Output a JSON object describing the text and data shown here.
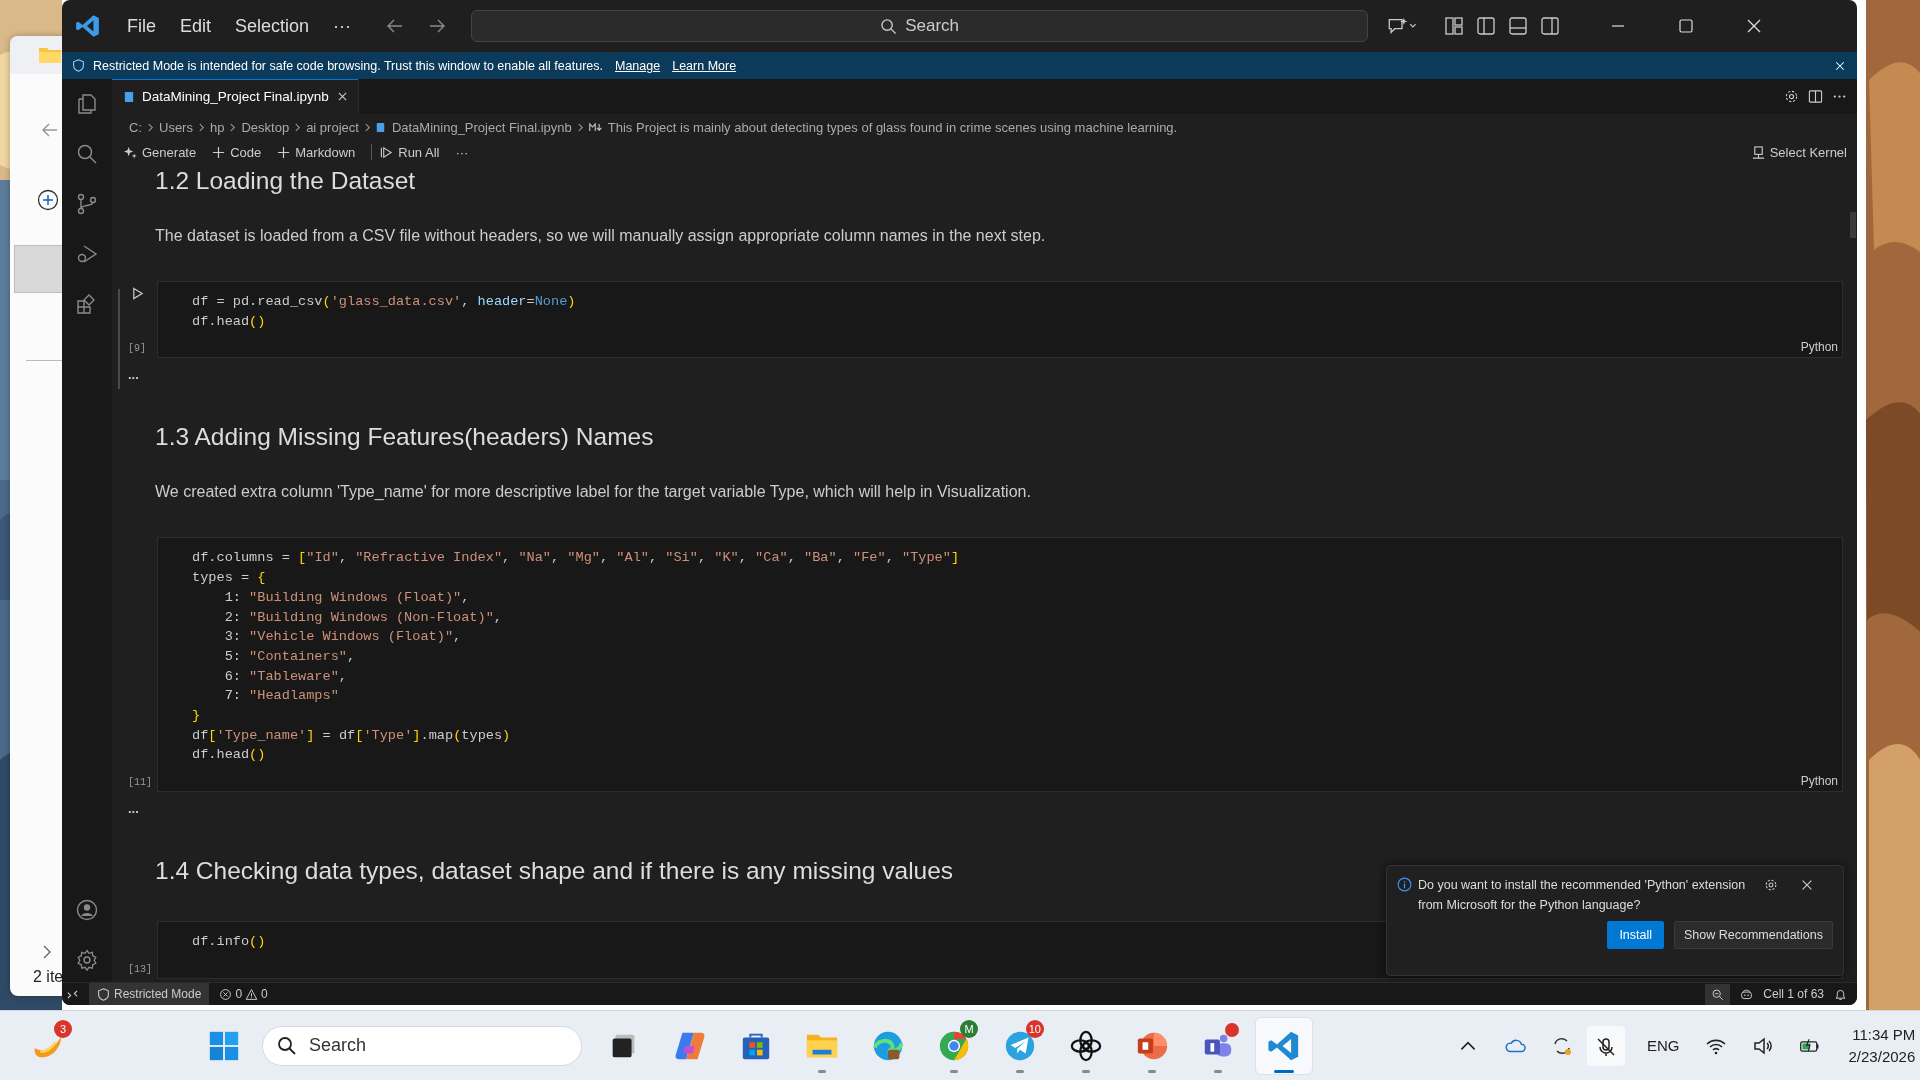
{
  "explorer_window": {
    "status_text": "2 ite"
  },
  "vscode": {
    "menu": [
      "File",
      "Edit",
      "Selection",
      "···"
    ],
    "command_center": {
      "placeholder": "Search"
    },
    "banner": {
      "message": "Restricted Mode is intended for safe code browsing. Trust this window to enable all features.",
      "links": [
        "Manage",
        "Learn More"
      ]
    },
    "tabs": [
      {
        "label": "DataMining_Project Final.ipynb",
        "selected": true
      }
    ],
    "breadcrumbs": [
      {
        "label": "C:",
        "kind": "plain"
      },
      {
        "label": "Users",
        "kind": "plain"
      },
      {
        "label": "hp",
        "kind": "plain"
      },
      {
        "label": "Desktop",
        "kind": "plain"
      },
      {
        "label": "ai project",
        "kind": "plain"
      },
      {
        "label": "DataMining_Project Final.ipynb",
        "kind": "notebook"
      },
      {
        "label": "This Project is mainly about detecting types of glass found in crime scenes using machine learning.",
        "kind": "markdown"
      }
    ],
    "toolbar": [
      {
        "label": "Generate",
        "kind": "sparkle"
      },
      {
        "label": "Code",
        "kind": "add"
      },
      {
        "label": "Markdown",
        "kind": "add"
      },
      {
        "label": "Run All",
        "kind": "run"
      },
      {
        "label": "···",
        "kind": "more"
      }
    ],
    "kernel": "Select Kernel",
    "cells": [
      {
        "kind": "markdown",
        "heading": "1.2 Loading the Dataset",
        "text": "The dataset is loaded from a CSV file without headers, so we will manually assign appropriate column names in the next step."
      },
      {
        "kind": "code",
        "focused": true,
        "execution_count": "[9]",
        "language": "Python",
        "output": "...",
        "lines": [
          [
            {
              "kind": "plain",
              "text": "df = pd.read_csv"
            },
            {
              "kind": "bracket",
              "text": "("
            },
            {
              "kind": "string",
              "text": "'glass_data.csv'"
            },
            {
              "kind": "plain",
              "text": ", "
            },
            {
              "kind": "param",
              "text": "header"
            },
            {
              "kind": "plain",
              "text": "="
            },
            {
              "kind": "keyword",
              "text": "None"
            },
            {
              "kind": "bracket",
              "text": ")"
            }
          ],
          [
            {
              "kind": "plain",
              "text": "df.head"
            },
            {
              "kind": "bracket",
              "text": "()"
            }
          ]
        ]
      },
      {
        "kind": "markdown",
        "heading": "1.3 Adding Missing Features(headers) Names",
        "text": "We created extra column 'Type_name' for more descriptive label for the target variable Type, which will help in Visualization."
      },
      {
        "kind": "code",
        "focused": false,
        "execution_count": "[11]",
        "language": "Python",
        "output": "...",
        "lines": [
          [
            {
              "kind": "plain",
              "text": "df.columns = "
            },
            {
              "kind": "bracket",
              "text": "["
            },
            {
              "kind": "string",
              "text": "\"Id\""
            },
            {
              "kind": "plain",
              "text": ", "
            },
            {
              "kind": "string",
              "text": "\"Refractive Index\""
            },
            {
              "kind": "plain",
              "text": ", "
            },
            {
              "kind": "string",
              "text": "\"Na\""
            },
            {
              "kind": "plain",
              "text": ", "
            },
            {
              "kind": "string",
              "text": "\"Mg\""
            },
            {
              "kind": "plain",
              "text": ", "
            },
            {
              "kind": "string",
              "text": "\"Al\""
            },
            {
              "kind": "plain",
              "text": ", "
            },
            {
              "kind": "string",
              "text": "\"Si\""
            },
            {
              "kind": "plain",
              "text": ", "
            },
            {
              "kind": "string",
              "text": "\"K\""
            },
            {
              "kind": "plain",
              "text": ", "
            },
            {
              "kind": "string",
              "text": "\"Ca\""
            },
            {
              "kind": "plain",
              "text": ", "
            },
            {
              "kind": "string",
              "text": "\"Ba\""
            },
            {
              "kind": "plain",
              "text": ", "
            },
            {
              "kind": "string",
              "text": "\"Fe\""
            },
            {
              "kind": "plain",
              "text": ", "
            },
            {
              "kind": "string",
              "text": "\"Type\""
            },
            {
              "kind": "bracket",
              "text": "]"
            }
          ],
          [
            {
              "kind": "plain",
              "text": "types = "
            },
            {
              "kind": "bracket",
              "text": "{"
            }
          ],
          [
            {
              "kind": "plain",
              "text": "    1: "
            },
            {
              "kind": "string",
              "text": "\"Building Windows (Float)\""
            },
            {
              "kind": "plain",
              "text": ","
            }
          ],
          [
            {
              "kind": "plain",
              "text": "    2: "
            },
            {
              "kind": "string",
              "text": "\"Building Windows (Non-Float)\""
            },
            {
              "kind": "plain",
              "text": ","
            }
          ],
          [
            {
              "kind": "plain",
              "text": "    3: "
            },
            {
              "kind": "string",
              "text": "\"Vehicle Windows (Float)\""
            },
            {
              "kind": "plain",
              "text": ","
            }
          ],
          [
            {
              "kind": "plain",
              "text": "    5: "
            },
            {
              "kind": "string",
              "text": "\"Containers\""
            },
            {
              "kind": "plain",
              "text": ","
            }
          ],
          [
            {
              "kind": "plain",
              "text": "    6: "
            },
            {
              "kind": "string",
              "text": "\"Tableware\""
            },
            {
              "kind": "plain",
              "text": ","
            }
          ],
          [
            {
              "kind": "plain",
              "text": "    7: "
            },
            {
              "kind": "string",
              "text": "\"Headlamps\""
            }
          ],
          [
            {
              "kind": "bracket",
              "text": "}"
            }
          ],
          [
            {
              "kind": "plain",
              "text": "df"
            },
            {
              "kind": "bracket",
              "text": "["
            },
            {
              "kind": "string",
              "text": "'Type_name'"
            },
            {
              "kind": "bracket",
              "text": "]"
            },
            {
              "kind": "plain",
              "text": " = df"
            },
            {
              "kind": "bracket",
              "text": "["
            },
            {
              "kind": "string",
              "text": "'Type'"
            },
            {
              "kind": "bracket",
              "text": "]"
            },
            {
              "kind": "plain",
              "text": ".map"
            },
            {
              "kind": "bracket",
              "text": "("
            },
            {
              "kind": "plain",
              "text": "types"
            },
            {
              "kind": "bracket",
              "text": ")"
            }
          ],
          [
            {
              "kind": "plain",
              "text": "df.head"
            },
            {
              "kind": "bracket",
              "text": "()"
            }
          ]
        ]
      },
      {
        "kind": "markdown",
        "heading": "1.4 Checking data types, dataset shape and if there is any missing values"
      },
      {
        "kind": "code",
        "focused": false,
        "execution_count": "[13]",
        "lines": [
          [
            {
              "kind": "plain",
              "text": "df.info"
            },
            {
              "kind": "bracket",
              "text": "()"
            }
          ]
        ]
      }
    ],
    "notification": {
      "message": "Do you want to install the recommended 'Python' extension from Microsoft for the Python language?",
      "buttons": [
        {
          "label": "Install",
          "primary": true
        },
        {
          "label": "Show Recommendations",
          "primary": false
        }
      ]
    },
    "status_bar": {
      "restricted": "Restricted Mode",
      "errors": "0",
      "warnings": "0",
      "cell_position": "Cell 1 of 63"
    }
  },
  "taskbar": {
    "apps": [
      {
        "kind": "swirl",
        "badge": "3",
        "dot": false,
        "running": false,
        "selected": false
      },
      {
        "kind": "start",
        "dot": false,
        "running": false,
        "selected": false
      },
      {
        "kind": "search"
      },
      {
        "kind": "taskview",
        "dot": false,
        "running": false,
        "selected": false
      },
      {
        "kind": "copilot",
        "dot": false,
        "running": false,
        "selected": false
      },
      {
        "kind": "store",
        "dot": false,
        "running": false,
        "selected": false
      },
      {
        "kind": "explorer",
        "dot": false,
        "running": true,
        "selected": false
      },
      {
        "kind": "edge",
        "dot": false,
        "running": false,
        "selected": false
      },
      {
        "kind": "chrome",
        "badge": "M",
        "dot": false,
        "running": true,
        "selected": false
      },
      {
        "kind": "telegram",
        "badge": "10",
        "dot": false,
        "running": true,
        "selected": false
      },
      {
        "kind": "chatgpt",
        "dot": false,
        "running": true,
        "selected": false
      },
      {
        "kind": "powerpoint",
        "dot": false,
        "running": true,
        "selected": false
      },
      {
        "kind": "teams",
        "dot": true,
        "running": true,
        "selected": false
      },
      {
        "kind": "vscode",
        "dot": false,
        "running": true,
        "selected": true
      }
    ],
    "search": {
      "placeholder": "Search"
    },
    "tray": {
      "language": "ENG",
      "time": "11:34 PM",
      "date": "2/23/2026"
    }
  }
}
